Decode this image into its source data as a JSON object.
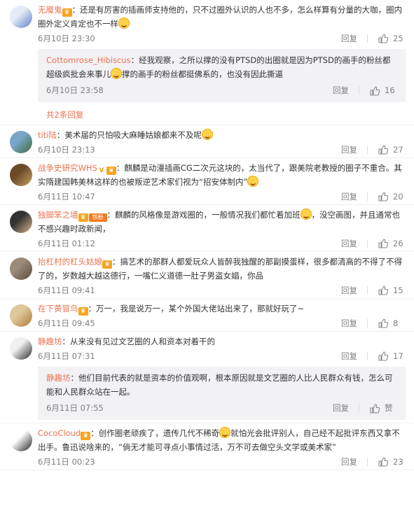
{
  "reply_label": "回复",
  "comments": [
    {
      "user": "无魇鬼",
      "badges": [
        "level"
      ],
      "text": "：还是有厉害的插画师支持他的，只不过圈外认识的人也不多，怎么样算有分量的大咖，圈内圈外定义肯定也不一样",
      "emoji_end": true,
      "time": "6月10日 23:30",
      "likes": "25",
      "avatar_colors": [
        "#e5ecf7",
        "#5b7fc8"
      ],
      "sub": {
        "user": "Cottomrose_Hibiscus",
        "text_a": "：经我观察，之所以撑的没有PTSD的出圈就是因为PTSD的画手的粉丝都超级疯批会来事儿",
        "text_b": "撑的画手的粉丝都挺佛系的，也没有因此撕逼",
        "time": "6月10日 23:58",
        "likes": "16",
        "more": "共2条回复"
      }
    },
    {
      "user": "titi陆",
      "badges": [],
      "text": "：美术届的只怕吸大麻睡姑娘都来不及呢",
      "emoji_end": true,
      "time": "6月10日 23:13",
      "likes": "27",
      "avatar_colors": [
        "#7aa7c9",
        "#3d6b3a"
      ]
    },
    {
      "user": "战争史研究WHS",
      "badges": [
        "v",
        "level"
      ],
      "text": "：麒麟是动漫插画CG二次元这块的，太当代了，跟美院老教授的圈子不重合。其实隋建国韩美林这样的也被叛逆艺术家们视为“招安体制内”",
      "emoji_end": true,
      "time": "6月11日 10:47",
      "likes": "20",
      "avatar_colors": [
        "#6b4a2a",
        "#c8a060"
      ]
    },
    {
      "user": "独脚笨之墙",
      "badges": [
        "level",
        "fan"
      ],
      "fan_label": "铁粉",
      "text_a": "：麒麟的风格像是游戏圈的，一般情况我们都忙着加班",
      "text_b": "，没空画图，并且通常也不感兴趣时政新闻，",
      "time": "6月11日 01:12",
      "likes": "26",
      "avatar_colors": [
        "#333333",
        "#d9b48a"
      ]
    },
    {
      "user": "抬杠村的杠头姑娘",
      "badges": [
        "level"
      ],
      "text": "：搞艺术的那群人都爱玩众人皆醉我独醒的那副摸蛋样，很多都清高的不得了不得了的，岁数越大越这德行，一嘴仁义道德一肚子男盗女娼，你品",
      "emoji_end": false,
      "time": "6月11日 09:41",
      "likes": "15",
      "avatar_colors": [
        "#9a8a7a",
        "#5a4a3a"
      ]
    },
    {
      "user": "在下黄冒鸟",
      "badges": [
        "level"
      ],
      "text": "：万一，我是说万一，某个外国大佬站出来了，那就好玩了~",
      "emoji_end": false,
      "time": "6月11日 09:45",
      "likes": "8",
      "avatar_colors": [
        "#e0c89a",
        "#b07a3a"
      ]
    },
    {
      "user": "静趣坊",
      "badges": [],
      "text": "：从来没有见过文艺圈的人和资本对着干的",
      "emoji_end": false,
      "time": "6月11日 07:31",
      "likes": "17",
      "avatar_colors": [
        "#f0f0f0",
        "#2a2a2a"
      ],
      "sub": {
        "user": "静趣坊",
        "text_a": "：他们目前代表的就是资本的价值观啊，根本原因就是文艺圈的人比人民群众有钱，怎么可能和人民群众站在一起。",
        "text_b": "",
        "time": "6月11日 07:55",
        "likes": "赞",
        "more": ""
      }
    },
    {
      "user": "CocoCloud",
      "badges": [
        "level"
      ],
      "text_a": "：创作圈老顽疾了，遗传几代不稀奇",
      "text_b": "就怕光会批评别人，自己经不起批评东西又拿不出手。鲁迅说啥来的，“倘无才能可寻点小事情过活，万不可去做空头文学或美术家”",
      "time": "6月11日 00:23",
      "likes": "23",
      "avatar_colors": [
        "#ffffff",
        "#222222"
      ]
    }
  ]
}
